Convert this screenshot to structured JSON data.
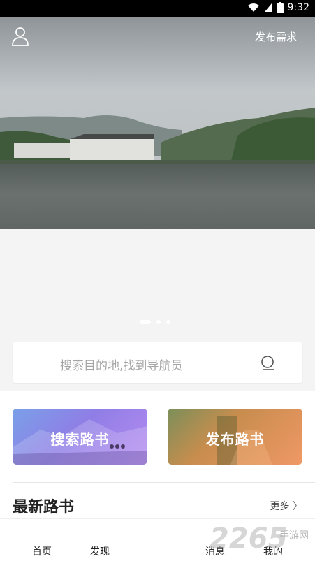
{
  "statusbar": {
    "time": "9:32"
  },
  "header": {
    "publish_label": "发布需求"
  },
  "carousel": {
    "count": 3,
    "active": 0
  },
  "search": {
    "placeholder": "搜索目的地,找到导航员"
  },
  "actions": [
    {
      "label": "搜索路书"
    },
    {
      "label": "发布路书"
    }
  ],
  "section": {
    "title": "最新路书",
    "more": "更多"
  },
  "tabs": [
    {
      "label": "首页"
    },
    {
      "label": "发现"
    },
    {
      "label": "消息"
    },
    {
      "label": "我的"
    }
  ],
  "watermark": {
    "brand": "2265",
    "sub": "手游网"
  }
}
